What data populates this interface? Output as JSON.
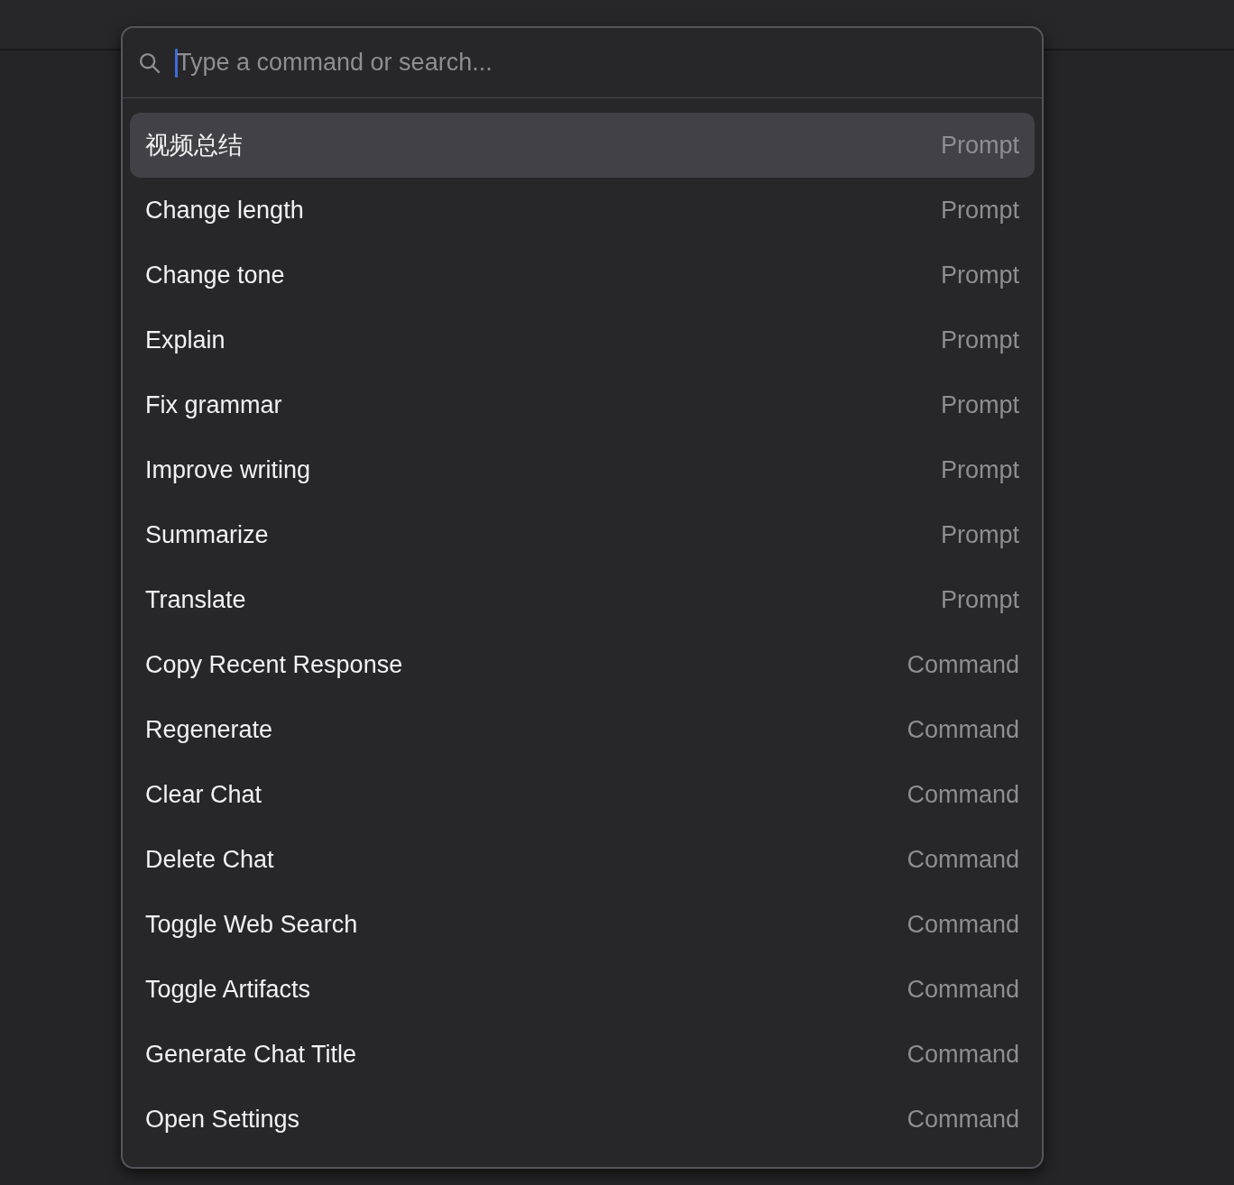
{
  "search": {
    "placeholder": "Type a command or search..."
  },
  "items": [
    {
      "label": "视频总结",
      "type": "Prompt",
      "selected": true
    },
    {
      "label": "Change length",
      "type": "Prompt",
      "selected": false
    },
    {
      "label": "Change tone",
      "type": "Prompt",
      "selected": false
    },
    {
      "label": "Explain",
      "type": "Prompt",
      "selected": false
    },
    {
      "label": "Fix grammar",
      "type": "Prompt",
      "selected": false
    },
    {
      "label": "Improve writing",
      "type": "Prompt",
      "selected": false
    },
    {
      "label": "Summarize",
      "type": "Prompt",
      "selected": false
    },
    {
      "label": "Translate",
      "type": "Prompt",
      "selected": false
    },
    {
      "label": "Copy Recent Response",
      "type": "Command",
      "selected": false
    },
    {
      "label": "Regenerate",
      "type": "Command",
      "selected": false
    },
    {
      "label": "Clear Chat",
      "type": "Command",
      "selected": false
    },
    {
      "label": "Delete Chat",
      "type": "Command",
      "selected": false
    },
    {
      "label": "Toggle Web Search",
      "type": "Command",
      "selected": false
    },
    {
      "label": "Toggle Artifacts",
      "type": "Command",
      "selected": false
    },
    {
      "label": "Generate Chat Title",
      "type": "Command",
      "selected": false
    },
    {
      "label": "Open Settings",
      "type": "Command",
      "selected": false
    }
  ]
}
